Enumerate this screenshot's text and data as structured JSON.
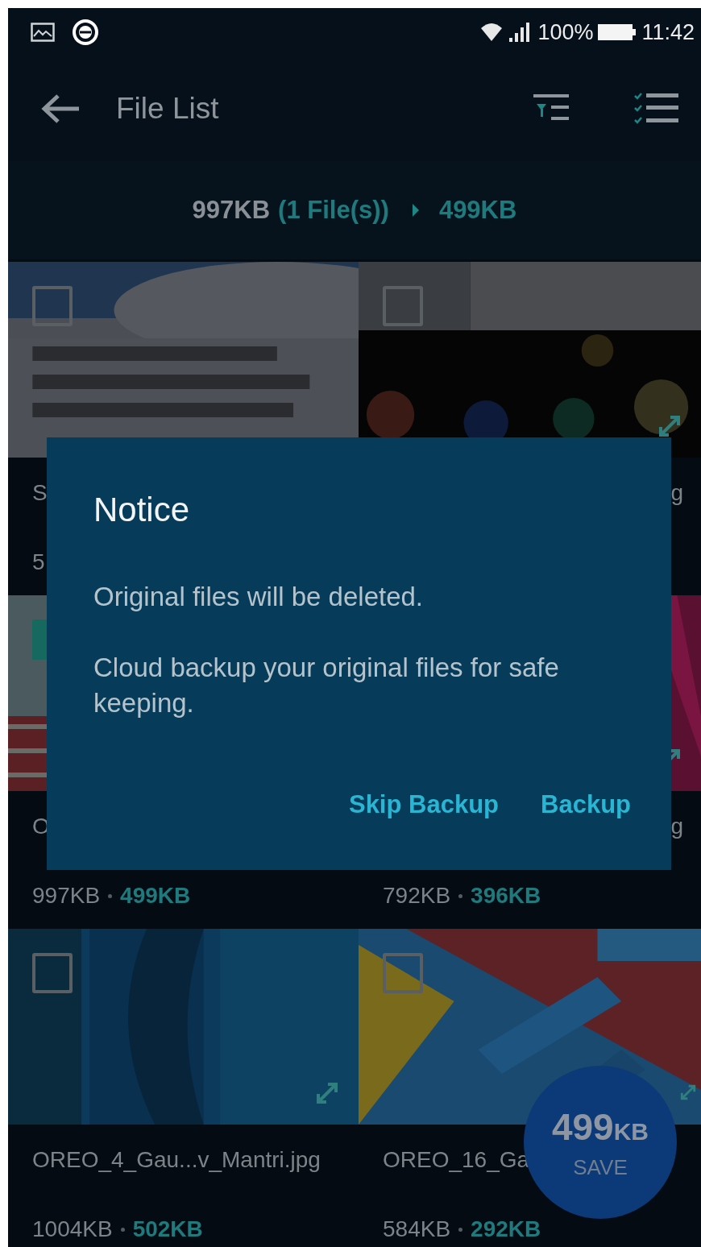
{
  "status_bar": {
    "battery": "100%",
    "time": "11:42"
  },
  "app_bar": {
    "title": "File List"
  },
  "summary": {
    "original": "997KB",
    "count": "(1 File(s))",
    "result": "499KB"
  },
  "tiles": [
    {
      "kind": "picture",
      "checked": false,
      "name": "S",
      "sizes": {
        "original": "5"
      }
    },
    {
      "kind": "picture",
      "checked": false,
      "name_tail": "g"
    },
    {
      "kind": "picture",
      "checked": true,
      "name": "O",
      "sizes": {
        "original": "997KB",
        "result": "499KB"
      }
    },
    {
      "kind": "picture",
      "name_tail": "g",
      "sizes": {
        "original": "792KB",
        "result": "396KB"
      }
    },
    {
      "kind": "picture",
      "checked": false,
      "name": "OREO_4_Gau...v_Mantri.jpg",
      "sizes": {
        "original": "1004KB",
        "result": "502KB"
      }
    },
    {
      "kind": "picture",
      "checked": false,
      "name": "OREO_16_Ga",
      "sizes": {
        "original": "584KB",
        "result": "292KB"
      }
    }
  ],
  "save_button": {
    "value": "499",
    "unit": "KB",
    "label": "SAVE"
  },
  "dialog": {
    "title": "Notice",
    "paragraphs": [
      "Original files will be deleted.",
      "Cloud backup your original files for safe keeping."
    ],
    "buttons": [
      "Skip Backup",
      "Backup"
    ]
  }
}
